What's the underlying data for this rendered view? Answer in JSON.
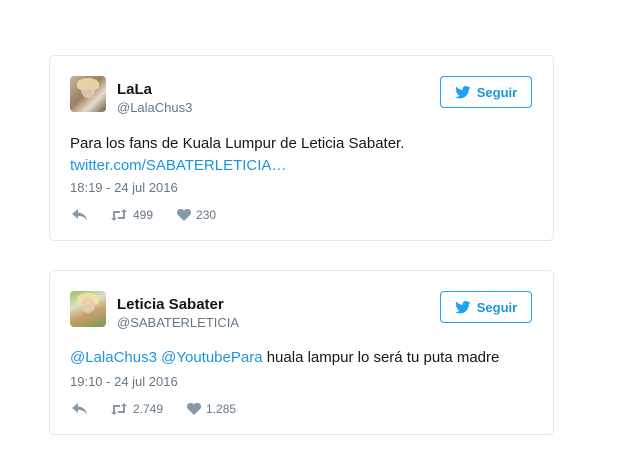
{
  "tweets": [
    {
      "user": {
        "name": "LaLa",
        "handle": "@LalaChus3"
      },
      "follow_label": "Seguir",
      "text": "Para los fans de Kuala Lumpur de Leticia Sabater.",
      "link": "twitter.com/SABATERLETICIA…",
      "timestamp": "18:19 - 24 jul 2016",
      "retweets": "499",
      "likes": "230"
    },
    {
      "user": {
        "name": "Leticia Sabater",
        "handle": "@SABATERLETICIA"
      },
      "follow_label": "Seguir",
      "mentions": [
        "@LalaChus3",
        "@YoutubePara"
      ],
      "text": "huala lampur lo será tu puta madre",
      "timestamp": "19:10 - 24 jul 2016",
      "retweets": "2.749",
      "likes": "1.285"
    }
  ],
  "colors": {
    "link": "#1b95e0",
    "muted": "#657786",
    "border": "#e1e8ed",
    "text": "#14171a"
  },
  "icons": [
    "twitter-bird-icon",
    "reply-icon",
    "retweet-icon",
    "heart-icon"
  ]
}
